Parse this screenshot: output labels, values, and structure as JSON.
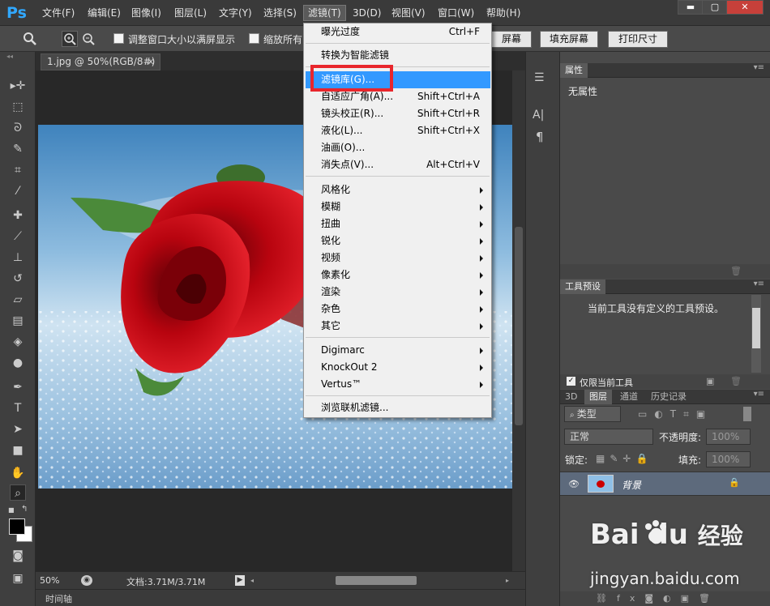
{
  "app": {
    "logo": "Ps"
  },
  "menubar": {
    "items": [
      "文件(F)",
      "编辑(E)",
      "图像(I)",
      "图层(L)",
      "文字(Y)",
      "选择(S)",
      "滤镜(T)",
      "3D(D)",
      "视图(V)",
      "窗口(W)",
      "帮助(H)"
    ],
    "active": "滤镜(T)"
  },
  "window_controls": {
    "minimize": "▬",
    "maximize": "▢",
    "close": "✕"
  },
  "options": {
    "resize_label": "调整窗口大小以满屏显示",
    "zoom_all_label": "缩放所有",
    "fit_screen": "屏幕",
    "fill_screen": "填充屏幕",
    "print_size": "打印尺寸"
  },
  "document": {
    "tab_label": "1.jpg @ 50%(RGB/8#)",
    "tab_close": "×",
    "zoom": "50%",
    "doc_size": "文档:3.71M/3.71M",
    "timeline_label": "时间轴"
  },
  "filter_menu": {
    "items": [
      {
        "label": "曝光过度",
        "shortcut": "Ctrl+F"
      },
      {
        "label": "转换为智能滤镜",
        "shortcut": ""
      },
      {
        "label": "滤镜库(G)...",
        "shortcut": ""
      },
      {
        "label": "自适应广角(A)...",
        "shortcut": "Shift+Ctrl+A"
      },
      {
        "label": "镜头校正(R)...",
        "shortcut": "Shift+Ctrl+R"
      },
      {
        "label": "液化(L)...",
        "shortcut": "Shift+Ctrl+X"
      },
      {
        "label": "油画(O)...",
        "shortcut": ""
      },
      {
        "label": "消失点(V)...",
        "shortcut": "Alt+Ctrl+V"
      },
      {
        "label": "风格化",
        "shortcut": ""
      },
      {
        "label": "模糊",
        "shortcut": ""
      },
      {
        "label": "扭曲",
        "shortcut": ""
      },
      {
        "label": "锐化",
        "shortcut": ""
      },
      {
        "label": "视频",
        "shortcut": ""
      },
      {
        "label": "像素化",
        "shortcut": ""
      },
      {
        "label": "渲染",
        "shortcut": ""
      },
      {
        "label": "杂色",
        "shortcut": ""
      },
      {
        "label": "其它",
        "shortcut": ""
      },
      {
        "label": "Digimarc",
        "shortcut": ""
      },
      {
        "label": "KnockOut 2",
        "shortcut": ""
      },
      {
        "label": "Vertus™",
        "shortcut": ""
      },
      {
        "label": "浏览联机滤镜...",
        "shortcut": ""
      }
    ],
    "highlighted": "滤镜库(G)..."
  },
  "properties_panel": {
    "tab": "属性",
    "content": "无属性"
  },
  "tool_presets_panel": {
    "tab": "工具预设",
    "message": "当前工具没有定义的工具预设。",
    "checkbox_label": "仅限当前工具",
    "checked": true
  },
  "layers_panel": {
    "tabs": [
      "3D",
      "图层",
      "通道",
      "历史记录"
    ],
    "active_tab": "图层",
    "filter_kind": "类型",
    "blend_mode": "正常",
    "opacity_label": "不透明度:",
    "opacity_value": "100%",
    "lock_label": "锁定:",
    "fill_label": "填充:",
    "fill_value": "100%",
    "layers": [
      {
        "name": "背景",
        "visible": true,
        "locked": true
      }
    ]
  },
  "dock": {
    "text_icon": "A|",
    "paragraph_icon": "¶"
  },
  "watermark": {
    "brand": "Bai du",
    "brand_cn": "经验",
    "url": "jingyan.baidu.com"
  },
  "colors": {
    "accent": "#3399ff",
    "highlight_box": "#e8262c",
    "menubar": "#3a3a3a",
    "panel": "#4a4a4a"
  }
}
